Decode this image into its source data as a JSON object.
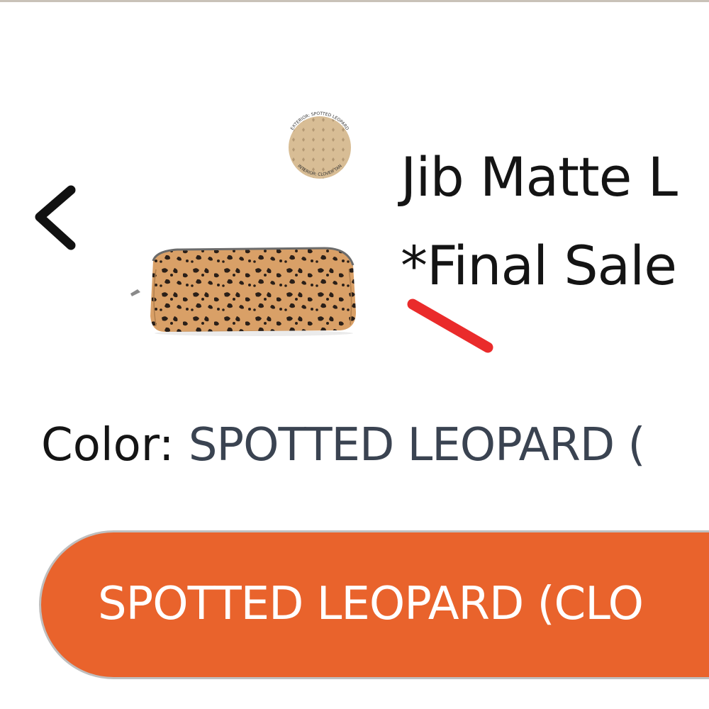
{
  "product": {
    "title": "Jib Matte L",
    "sale_note": "*Final Sale",
    "swatch": {
      "exterior_text": "EXTERIOR: SPOTTED LEOPARD",
      "interior_text": "INTERIOR: CLOVER TAN"
    },
    "color_label": "Color:",
    "color_value": "SPOTTED LEOPARD ("
  },
  "variant_button": {
    "label": "SPOTTED LEOPARD (CLO"
  },
  "navigation": {
    "back_icon": "chevron-left-icon"
  },
  "colors": {
    "accent": "#e9632c",
    "annotation": "#ea2b2b",
    "text": "#141414",
    "value_text": "#3a4351",
    "swatch_tan": "#d8bd95"
  }
}
